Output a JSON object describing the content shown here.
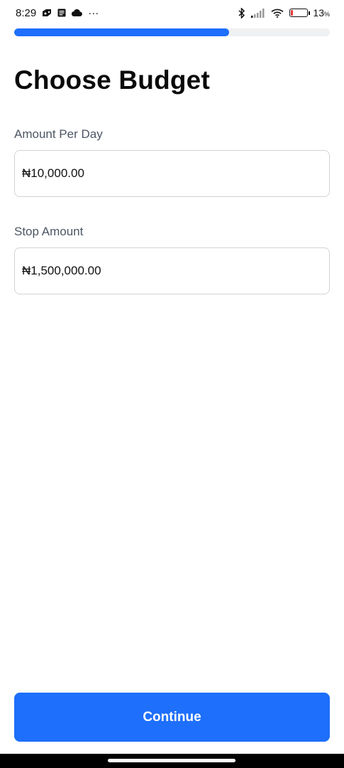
{
  "status_bar": {
    "time": "8:29",
    "more": "···",
    "battery_percent": "13",
    "battery_level": 0.13,
    "battery_color": "#e53935",
    "icons": [
      "carrier-app-icon",
      "notes-icon",
      "cloud-icon",
      "bluetooth-icon",
      "signal-icon",
      "wifi-icon",
      "battery-icon"
    ]
  },
  "progress": {
    "value": 0.68,
    "color": "#1e6ffb"
  },
  "page": {
    "title": "Choose Budget"
  },
  "fields": {
    "amount_per_day": {
      "label": "Amount Per Day",
      "value": "₦10,000.00"
    },
    "stop_amount": {
      "label": "Stop Amount",
      "value": "₦1,500,000.00"
    }
  },
  "actions": {
    "continue_label": "Continue",
    "accent_color": "#1e6ffb"
  }
}
